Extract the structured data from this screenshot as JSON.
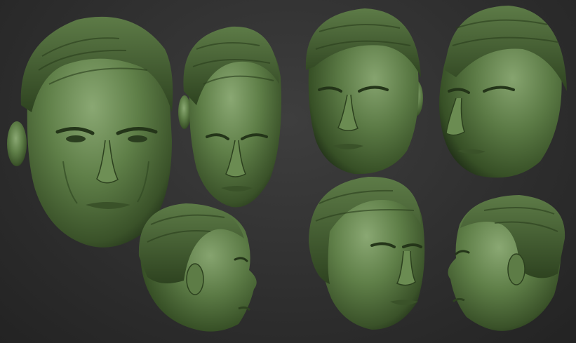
{
  "scene": {
    "colors": {
      "background": "#2f2f2f",
      "clay_base": "#4d6b3a",
      "clay_light": "#8aa873",
      "clay_shadow": "#1f2e17",
      "hair": "#3f5a2e"
    },
    "sculpts": [
      {
        "view": "front-three-quarter-large"
      },
      {
        "view": "downward-tilt"
      },
      {
        "view": "three-quarter-right"
      },
      {
        "view": "three-quarter-left"
      },
      {
        "view": "profile-right-facing"
      },
      {
        "view": "three-quarter-low"
      },
      {
        "view": "profile-left-facing"
      }
    ]
  }
}
